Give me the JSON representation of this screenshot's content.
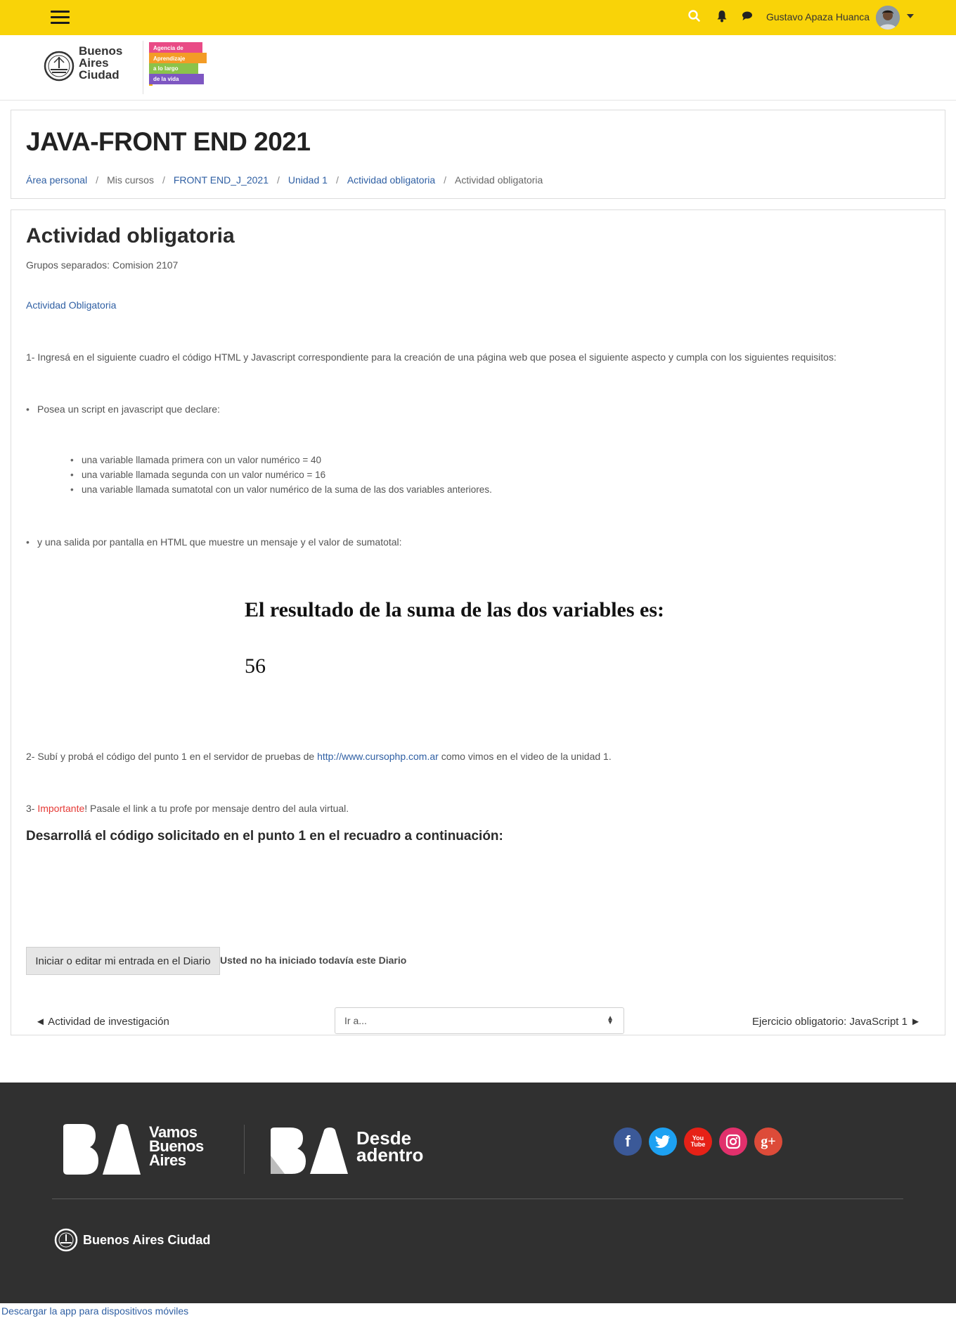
{
  "navbar": {
    "user_name": "Gustavo Apaza Huanca",
    "icons": [
      "menu-icon",
      "search-icon",
      "bell-icon",
      "chat-icon",
      "chevron-down-icon"
    ],
    "background": "#f9d308"
  },
  "brand": {
    "city_logo_lines": [
      "Buenos",
      "Aires",
      "Ciudad"
    ],
    "agency_lines": [
      "Agencia de",
      "Aprendizaje",
      "a lo largo",
      "de la vida"
    ]
  },
  "header": {
    "course_title": "JAVA-FRONT END 2021",
    "breadcrumb": [
      {
        "label": "Área personal",
        "link": true
      },
      {
        "label": "Mis cursos",
        "link": false
      },
      {
        "label": "FRONT END_J_2021",
        "link": true
      },
      {
        "label": "Unidad 1",
        "link": true
      },
      {
        "label": "Actividad obligatoria",
        "link": true
      },
      {
        "label": "Actividad obligatoria",
        "link": false
      }
    ]
  },
  "main": {
    "title": "Actividad obligatoria",
    "groups": "Grupos separados: Comision 2107",
    "activity_link": "Actividad Obligatoria",
    "instruction_1": "1- Ingresá en el siguiente cuadro el código HTML y Javascript correspondiente para la creación de una página web que posea el siguiente aspecto y cumpla con los siguientes requisitos:",
    "bullet_script": "Posea un script en javascript que declare:",
    "sub_bullets": [
      "una variable llamada primera con un valor numérico = 40",
      "una variable llamada segunda con un valor numérico = 16",
      "una variable llamada sumatotal con un valor numérico de la suma de las dos variables anteriores."
    ],
    "bullet_output": "y una salida por pantalla en HTML que muestre un mensaje y el valor de sumatotal:",
    "result_heading": "El resultado de la suma de las dos variables es:",
    "result_value": "56",
    "instruction_2_prefix": "2- Subí y probá el código del punto 1 en el servidor de pruebas de ",
    "instruction_2_link": "http://www.cursophp.com.ar",
    "instruction_2_suffix": " como vimos en el video de la unidad 1.",
    "instruction_3_prefix": "3- ",
    "instruction_3_important": "Importante",
    "instruction_3_suffix": "! Pasale el link a tu profe por mensaje dentro del aula virtual.",
    "section_heading": "Desarrollá el código solicitado en el punto 1 en el recuadro a continuación:",
    "journal_button": "Iniciar o editar mi entrada en el Diario",
    "journal_status": "Usted no ha iniciado todavía este Diario",
    "prev_activity": "◄ Actividad de investigación",
    "jump_placeholder": "Ir a...",
    "next_activity": "Ejercicio obligatorio: JavaScript 1 ►",
    "important_color": "#e53935"
  },
  "footer": {
    "vamos_lines": [
      "Vamos",
      "Buenos",
      "Aires"
    ],
    "desde_lines": [
      "Desde",
      "adentro"
    ],
    "city_name": "Buenos Aires Ciudad",
    "social": [
      {
        "name": "facebook",
        "glyph": "f",
        "color": "#3b5998"
      },
      {
        "name": "twitter",
        "glyph": "t",
        "color": "#1da1f2"
      },
      {
        "name": "youtube",
        "glyph": "You Tube",
        "color": "#e62117"
      },
      {
        "name": "instagram",
        "glyph": "◎",
        "color": "#e1306c"
      },
      {
        "name": "google-plus",
        "glyph": "g+",
        "color": "#dd4b39"
      }
    ],
    "background": "#303030"
  },
  "app_link": "Descargar la app para dispositivos móviles"
}
